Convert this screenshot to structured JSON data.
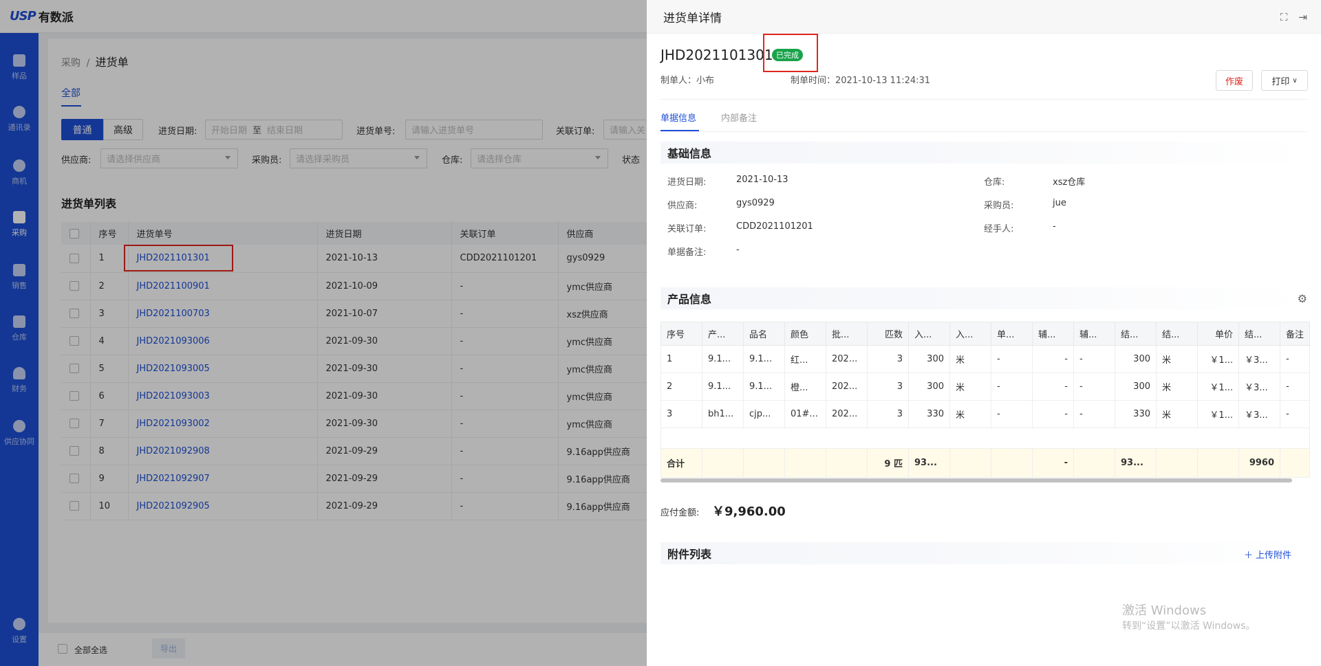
{
  "app": {
    "logo_mark": "USP",
    "logo_text": "有数派"
  },
  "sidebar": {
    "items": [
      {
        "label": "样品",
        "icon": "sample-icon"
      },
      {
        "label": "通讯录",
        "icon": "contacts-icon"
      },
      {
        "label": "商机",
        "icon": "opportunity-icon"
      },
      {
        "label": "采购",
        "icon": "purchase-icon"
      },
      {
        "label": "销售",
        "icon": "sales-icon"
      },
      {
        "label": "仓库",
        "icon": "warehouse-icon"
      },
      {
        "label": "财务",
        "icon": "finance-icon"
      },
      {
        "label": "供应协同",
        "icon": "supply-icon"
      },
      {
        "label": "设置",
        "icon": "gear-icon"
      }
    ]
  },
  "breadcrumb": {
    "parent": "采购",
    "sep": "/",
    "current": "进货单"
  },
  "tabs": {
    "all": "全部"
  },
  "filters": {
    "mode_normal": "普通",
    "mode_advanced": "高级",
    "date_label": "进货日期:",
    "date_start": "开始日期",
    "date_to": "至",
    "date_end": "结束日期",
    "no_label": "进货单号:",
    "no_placeholder": "请输入进货单号",
    "order_label": "关联订单:",
    "order_placeholder": "请输入关",
    "supplier_label": "供应商:",
    "supplier_placeholder": "请选择供应商",
    "buyer_label": "采购员:",
    "buyer_placeholder": "请选择采购员",
    "warehouse_label": "仓库:",
    "warehouse_placeholder": "请选择仓库",
    "status_label": "状态"
  },
  "list": {
    "title": "进货单列表",
    "columns": [
      "序号",
      "进货单号",
      "进货日期",
      "关联订单",
      "供应商"
    ],
    "rows": [
      [
        "1",
        "JHD2021101301",
        "2021-10-13",
        "CDD2021101201",
        "gys0929"
      ],
      [
        "2",
        "JHD2021100901",
        "2021-10-09",
        "-",
        "ymc供应商"
      ],
      [
        "3",
        "JHD2021100703",
        "2021-10-07",
        "-",
        "xsz供应商"
      ],
      [
        "4",
        "JHD2021093006",
        "2021-09-30",
        "-",
        "ymc供应商"
      ],
      [
        "5",
        "JHD2021093005",
        "2021-09-30",
        "-",
        "ymc供应商"
      ],
      [
        "6",
        "JHD2021093003",
        "2021-09-30",
        "-",
        "ymc供应商"
      ],
      [
        "7",
        "JHD2021093002",
        "2021-09-30",
        "-",
        "ymc供应商"
      ],
      [
        "8",
        "JHD2021092908",
        "2021-09-29",
        "-",
        "9.16app供应商"
      ],
      [
        "9",
        "JHD2021092907",
        "2021-09-29",
        "-",
        "9.16app供应商"
      ],
      [
        "10",
        "JHD2021092905",
        "2021-09-29",
        "-",
        "9.16app供应商"
      ]
    ]
  },
  "bottom": {
    "select_all": "全部全选",
    "export": "导出"
  },
  "drawer": {
    "title": "进货单详情",
    "doc_no": "JHD2021101301",
    "status": "已完成",
    "creator": "制单人：小布",
    "created_time": "制单时间：2021-10-13 11:24:31",
    "void_button": "作废",
    "print_button": "打印",
    "tab_info": "单据信息",
    "tab_notes": "内部备注",
    "basic": {
      "title": "基础信息",
      "fields": [
        {
          "label": "进货日期:",
          "value": "2021-10-13"
        },
        {
          "label": "仓库:",
          "value": "xsz仓库"
        },
        {
          "label": "供应商:",
          "value": "gys0929"
        },
        {
          "label": "采购员:",
          "value": "jue"
        },
        {
          "label": "关联订单:",
          "value": "CDD2021101201"
        },
        {
          "label": "经手人:",
          "value": "-"
        },
        {
          "label": "单据备注:",
          "value": "-"
        }
      ]
    },
    "product": {
      "title": "产品信息",
      "columns": [
        "序号",
        "产...",
        "品名",
        "颜色",
        "批...",
        "匹数",
        "入...",
        "入...",
        "单...",
        "辅...",
        "辅...",
        "结...",
        "结...",
        "单价",
        "结...",
        "备注"
      ],
      "rows": [
        [
          "1",
          "9.1...",
          "9.1...",
          "红...",
          "202...",
          "3",
          "300",
          "米",
          "-",
          "-",
          "-",
          "300",
          "米",
          "￥1...",
          "￥3...",
          "-"
        ],
        [
          "2",
          "9.1...",
          "9.1...",
          "橙...",
          "202...",
          "3",
          "300",
          "米",
          "-",
          "-",
          "-",
          "300",
          "米",
          "￥1...",
          "￥3...",
          "-"
        ],
        [
          "3",
          "bh1...",
          "cjp...",
          "01#...",
          "202...",
          "3",
          "330",
          "米",
          "-",
          "-",
          "-",
          "330",
          "米",
          "￥1...",
          "￥3...",
          "-"
        ]
      ],
      "total": [
        "合计",
        "",
        "",
        "",
        "",
        "9 匹",
        "93...",
        "",
        "",
        "-",
        "",
        "93...",
        "",
        "",
        "9960",
        ""
      ]
    },
    "amount_label": "应付金额:",
    "amount_value": "￥9,960.00",
    "attachments": {
      "title": "附件列表",
      "upload": "上传附件"
    }
  },
  "watermark": {
    "line1": "激活 Windows",
    "line2": "转到“设置”以激活 Windows。"
  }
}
